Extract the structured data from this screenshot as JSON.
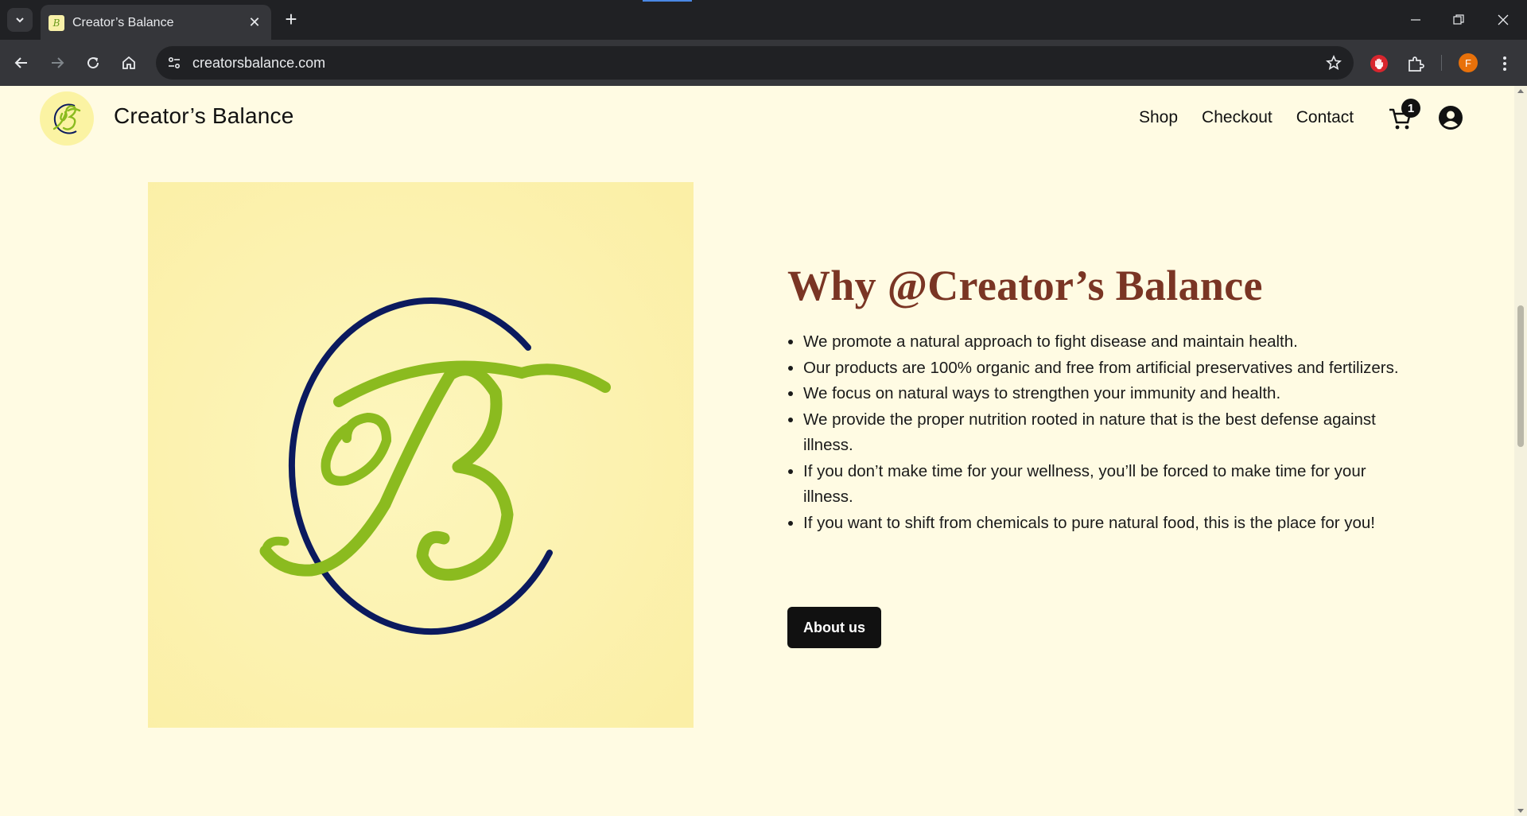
{
  "browser": {
    "tab_title": "Creator’s Balance",
    "url": "creatorsbalance.com",
    "profile_initial": "F"
  },
  "site": {
    "title": "Creator’s Balance",
    "nav": [
      "Shop",
      "Checkout",
      "Contact"
    ],
    "cart_count": "1"
  },
  "section": {
    "heading": "Why @Creator’s Balance",
    "features": [
      "We promote a natural approach to fight disease and maintain health.",
      "Our products are 100% organic and free from artificial preservatives and fertilizers.",
      "We focus on natural ways to strengthen your immunity and health.",
      "We provide the proper nutrition rooted in nature that is the best defense against illness.",
      "If you don’t make time for your wellness, you’ll be forced to make time for your illness.",
      "If you want to shift from chemicals to pure natural food, this is the place for you!"
    ],
    "button_label": "About us"
  },
  "colors": {
    "page_bg": "#fffbe3",
    "heading": "#7a3524",
    "logo_navy": "#0b1a5e",
    "logo_green": "#8bbb1f",
    "button_bg": "#111111"
  }
}
